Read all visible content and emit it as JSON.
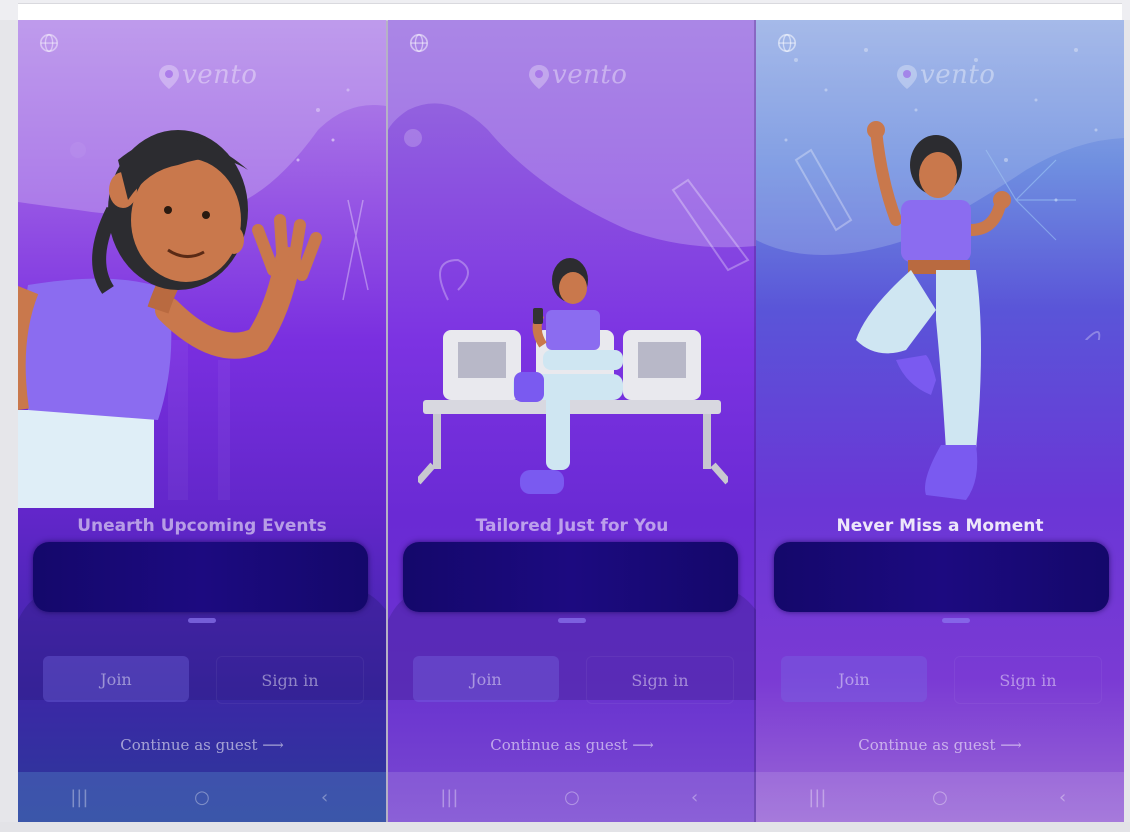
{
  "app": {
    "name": "vento"
  },
  "screens": [
    {
      "id": "onboarding-1",
      "title": "Unearth Upcoming Events",
      "illustration": "girl-waving",
      "join_label": "Join",
      "signin_label": "Sign in",
      "guest_label": "Continue as guest ⟶",
      "nav": {
        "recents": "|||",
        "home": "○",
        "back": "‹"
      }
    },
    {
      "id": "onboarding-2",
      "title": "Tailored Just for You",
      "illustration": "girl-on-bench-with-phone",
      "join_label": "Join",
      "signin_label": "Sign in",
      "guest_label": "Continue as guest ⟶",
      "nav": {
        "recents": "|||",
        "home": "○",
        "back": "‹"
      }
    },
    {
      "id": "onboarding-3",
      "title": "Never Miss a Moment",
      "illustration": "girl-jumping-fireworks",
      "join_label": "Join",
      "signin_label": "Sign in",
      "guest_label": "Continue as guest ⟶",
      "nav": {
        "recents": "|||",
        "home": "○",
        "back": "‹"
      }
    }
  ],
  "colors": {
    "accent": "#7a2fe0",
    "redaction": "#14086b",
    "skin": "#c9784c",
    "shirt": "#8b6cf0",
    "pants": "#cfe6f2"
  }
}
